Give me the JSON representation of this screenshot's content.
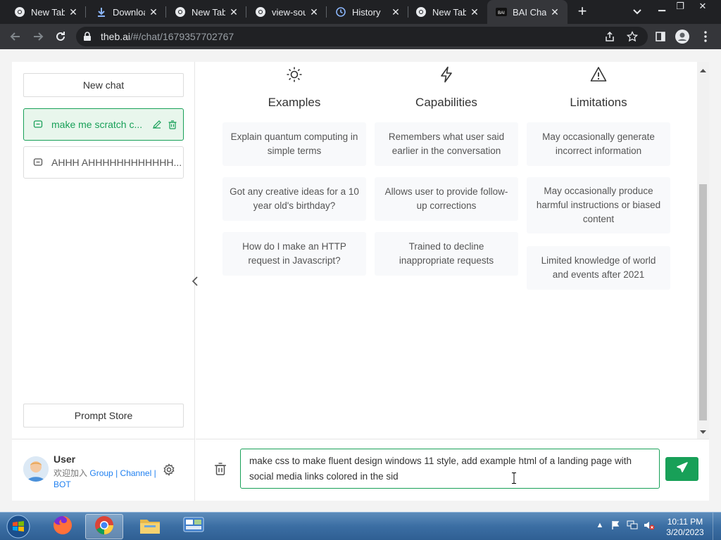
{
  "browser": {
    "tabs": [
      {
        "title": "New Tab",
        "icon": "chrome-icon",
        "active": false
      },
      {
        "title": "Downloads",
        "icon": "download-icon",
        "active": false
      },
      {
        "title": "New Tab",
        "icon": "chrome-icon",
        "active": false
      },
      {
        "title": "view-source",
        "icon": "chrome-icon",
        "active": false
      },
      {
        "title": "History",
        "icon": "history-icon",
        "active": false
      },
      {
        "title": "New Tab",
        "icon": "chrome-icon",
        "active": false
      },
      {
        "title": "BAI Chat",
        "icon": "bai-icon",
        "active": true
      }
    ],
    "url_host": "theb.ai",
    "url_path": "/#/chat/1679357702767"
  },
  "sidebar": {
    "new_chat_label": "New chat",
    "chats": [
      {
        "label": "make me scratch c...",
        "active": true
      },
      {
        "label": "AHHH AHHHHHHHHHHHH...",
        "active": false
      }
    ],
    "prompt_store_label": "Prompt Store",
    "user": {
      "name": "User",
      "join_text": "欢迎加入",
      "group_link": "Group",
      "channel_link": "Channel",
      "bot_link": "BOT",
      "sep": "|"
    }
  },
  "main": {
    "columns": [
      {
        "icon": "sun-icon",
        "heading": "Examples",
        "cards": [
          "Explain quantum computing in simple terms",
          "Got any creative ideas for a 10 year old's birthday?",
          "How do I make an HTTP request in Javascript?"
        ]
      },
      {
        "icon": "lightning-icon",
        "heading": "Capabilities",
        "cards": [
          "Remembers what user said earlier in the conversation",
          "Allows user to provide follow-up corrections",
          "Trained to decline inappropriate requests"
        ]
      },
      {
        "icon": "warning-icon",
        "heading": "Limitations",
        "cards": [
          "May occasionally generate incorrect information",
          "May occasionally produce harmful instructions or biased content",
          "Limited knowledge of world and events after 2021"
        ]
      }
    ]
  },
  "composer": {
    "value": "make css to make fluent design windows 11 style, add example html of a landing page with social media links colored in the sid"
  },
  "taskbar": {
    "time": "10:11 PM",
    "date": "3/20/2023",
    "apps": [
      "firefox-icon",
      "chrome-icon",
      "file-explorer-icon",
      "control-panel-icon"
    ]
  },
  "colors": {
    "accent": "#18a058",
    "browser_dark": "#202124",
    "toolbar": "#35363a",
    "link": "#2080f0"
  }
}
